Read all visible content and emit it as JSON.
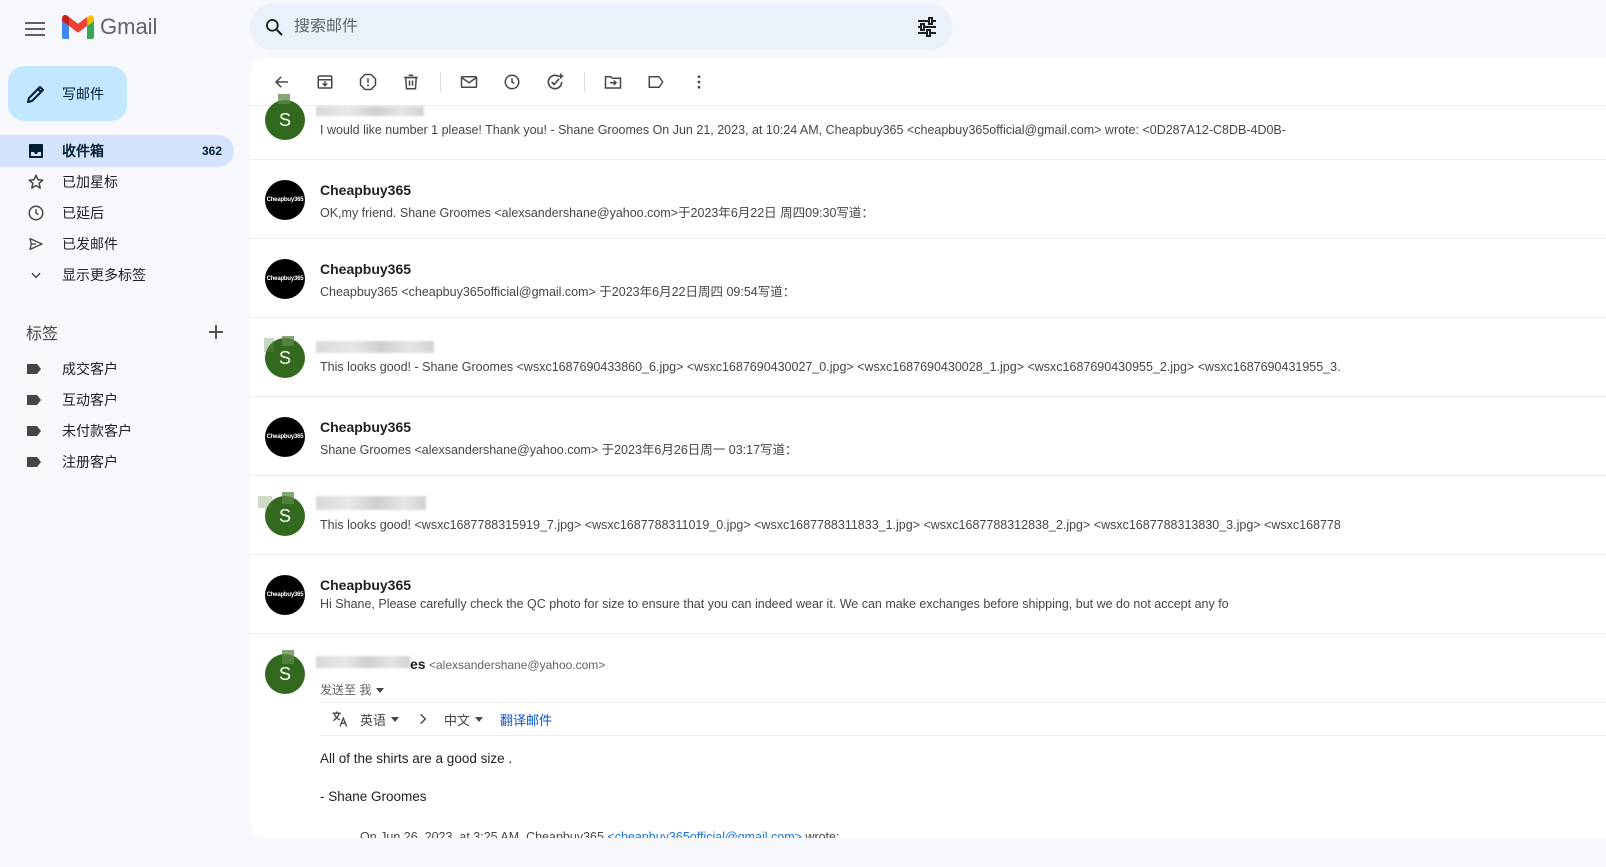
{
  "header": {
    "app_name": "Gmail",
    "search_placeholder": "搜索邮件"
  },
  "sidebar": {
    "compose_label": "写邮件",
    "items": [
      {
        "label": "收件箱",
        "count": "362",
        "icon": "inbox-icon"
      },
      {
        "label": "已加星标",
        "count": "",
        "icon": "star-icon"
      },
      {
        "label": "已延后",
        "count": "",
        "icon": "clock-icon"
      },
      {
        "label": "已发邮件",
        "count": "",
        "icon": "send-icon"
      },
      {
        "label": "显示更多标签",
        "count": "",
        "icon": "chevron-down-icon"
      }
    ],
    "labels_heading": "标签",
    "labels": [
      "成交客户",
      "互动客户",
      "未付款客户",
      "注册客户"
    ]
  },
  "messages": [
    {
      "sender": "",
      "avatar_letter": "S",
      "snippet": "I would like number 1 please! Thank you! - Shane Groomes On Jun 21, 2023, at 10:24 AM, Cheapbuy365 <cheapbuy365official@gmail.com> wrote:  <0D287A12-C8DB-4D0B-"
    },
    {
      "sender": "Cheapbuy365",
      "avatar_text": "Cheapbuy365",
      "snippet": "OK,my friend. Shane Groomes <alexsandershane@yahoo.com>于2023年6月22日 周四09:30写道："
    },
    {
      "sender": "Cheapbuy365",
      "avatar_text": "Cheapbuy365",
      "snippet": "Cheapbuy365 <cheapbuy365official@gmail.com> 于2023年6月22日周四 09:54写道："
    },
    {
      "sender": "",
      "avatar_letter": "S",
      "snippet": "This looks good! - Shane Groomes  <wsxc1687690433860_6.jpg> <wsxc1687690430027_0.jpg> <wsxc1687690430028_1.jpg> <wsxc1687690430955_2.jpg> <wsxc1687690431955_3."
    },
    {
      "sender": "Cheapbuy365",
      "avatar_text": "Cheapbuy365",
      "snippet": "Shane Groomes <alexsandershane@yahoo.com> 于2023年6月26日周一 03:17写道："
    },
    {
      "sender": "",
      "avatar_letter": "S",
      "snippet": "This looks good!  <wsxc1687788315919_7.jpg> <wsxc1687788311019_0.jpg> <wsxc1687788311833_1.jpg> <wsxc1687788312838_2.jpg> <wsxc1687788313830_3.jpg> <wsxc168778"
    },
    {
      "sender": "Cheapbuy365",
      "avatar_text": "Cheapbuy365",
      "snippet": "Hi Shane, Please carefully check the QC photo for size to ensure that you can indeed wear it. We can make exchanges before shipping, but we do not accept any fo"
    }
  ],
  "expanded": {
    "avatar_letter": "S",
    "sender_suffix": "es",
    "email": "<alexsandershane@yahoo.com>",
    "to_label": "发送至 我",
    "translate": {
      "from_lang": "英语",
      "to_lang": "中文",
      "action": "翻译邮件"
    },
    "body_line1": "All of the shirts are a good size .",
    "body_line2": "- Shane Groomes",
    "quote_prefix": "On Jun 26, 2023, at 3:25 AM, Cheapbuy365 ",
    "quote_link": "<cheapbuy365official@gmail.com>",
    "quote_suffix": " wrote:"
  }
}
